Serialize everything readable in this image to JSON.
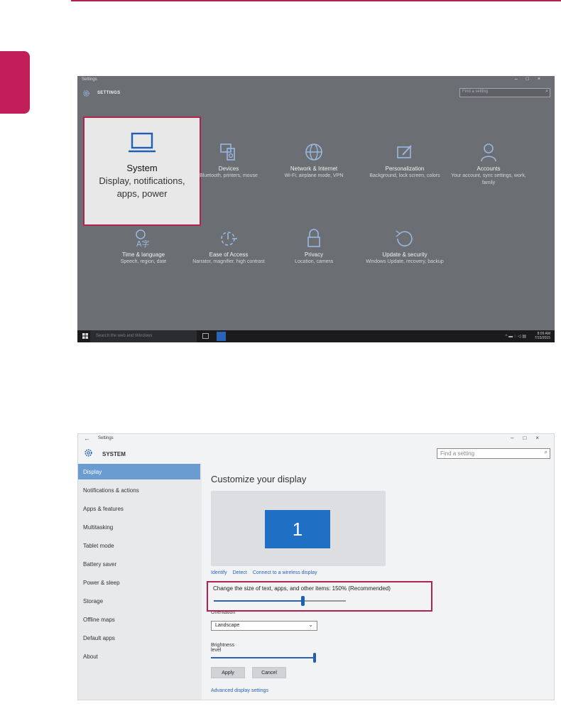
{
  "settings_home": {
    "window_title": "Settings",
    "window_controls": [
      "–",
      "□",
      "×"
    ],
    "heading": "SETTINGS",
    "search_placeholder": "Find a setting",
    "tiles": [
      {
        "title": "System",
        "subtitle": "Display, notifications, apps, power",
        "icon": "laptop-icon"
      },
      {
        "title": "Devices",
        "subtitle": "Bluetooth, printers, mouse",
        "icon": "devices-icon"
      },
      {
        "title": "Network & Internet",
        "subtitle": "Wi-Fi, airplane mode, VPN",
        "icon": "globe-icon"
      },
      {
        "title": "Personalization",
        "subtitle": "Background, lock screen, colors",
        "icon": "paint-icon"
      },
      {
        "title": "Accounts",
        "subtitle": "Your account, sync settings, work, family",
        "icon": "person-icon"
      },
      {
        "title": "Time & language",
        "subtitle": "Speech, region, date",
        "icon": "time-language-icon"
      },
      {
        "title": "Ease of Access",
        "subtitle": "Narrator, magnifier, high contrast",
        "icon": "ease-of-access-icon"
      },
      {
        "title": "Privacy",
        "subtitle": "Location, camera",
        "icon": "lock-icon"
      },
      {
        "title": "Update & security",
        "subtitle": "Windows Update, recovery, backup",
        "icon": "refresh-icon"
      }
    ],
    "taskbar": {
      "search_placeholder": "Search the web and Windows",
      "clock_time": "8:09 AM",
      "clock_date": "7/15/2015"
    }
  },
  "system_page": {
    "window_title": "Settings",
    "window_controls": [
      "–",
      "□",
      "×"
    ],
    "heading": "SYSTEM",
    "search_placeholder": "Find a setting",
    "nav": [
      {
        "label": "Display",
        "active": true
      },
      {
        "label": "Notifications & actions",
        "active": false
      },
      {
        "label": "Apps & features",
        "active": false
      },
      {
        "label": "Multitasking",
        "active": false
      },
      {
        "label": "Tablet mode",
        "active": false
      },
      {
        "label": "Battery saver",
        "active": false
      },
      {
        "label": "Power & sleep",
        "active": false
      },
      {
        "label": "Storage",
        "active": false
      },
      {
        "label": "Offline maps",
        "active": false
      },
      {
        "label": "Default apps",
        "active": false
      },
      {
        "label": "About",
        "active": false
      }
    ],
    "display": {
      "title": "Customize your display",
      "monitor_number": "1",
      "links": [
        "Identify",
        "Detect",
        "Connect to a wireless display"
      ],
      "scale_label": "Change the size of text, apps, and other items: 150% (Recommended)",
      "scale_fraction": 0.67,
      "orientation_label": "Orientation",
      "orientation_value": "Landscape",
      "brightness_label": "Brightness level",
      "brightness_fraction": 1.0,
      "apply_label": "Apply",
      "cancel_label": "Cancel",
      "advanced_link": "Advanced display settings"
    }
  },
  "colors": {
    "accent": "#b0234f",
    "link_blue": "#2a62b8",
    "nav_active": "#6a9bd1",
    "monitor_blue": "#1f6fc5"
  }
}
